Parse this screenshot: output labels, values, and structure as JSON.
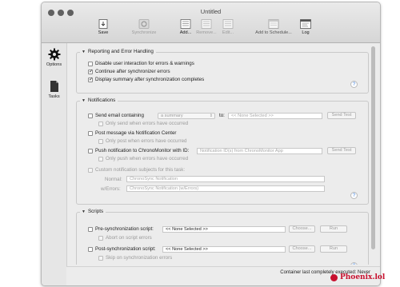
{
  "window": {
    "title": "Untitled"
  },
  "toolbar": {
    "save": "Save",
    "synchronize": "Synchronize",
    "add": "Add...",
    "remove": "Remove...",
    "edit": "Edit...",
    "add_to_schedule": "Add to Schedule...",
    "log": "Log"
  },
  "sidebar": {
    "options": "Options",
    "tasks": "Tasks"
  },
  "reporting": {
    "title": "Reporting and Error Handling",
    "items": [
      {
        "label": "Disable user interaction for errors & warnings",
        "checked": false
      },
      {
        "label": "Continue after synchronizer errors",
        "checked": true
      },
      {
        "label": "Display summary after synchronization completes",
        "checked": true
      }
    ]
  },
  "notifications": {
    "title": "Notifications",
    "send_email_label": "Send email containing",
    "send_email_select": "a summary",
    "to_label": "to:",
    "to_value": "<< None Selected >>",
    "send_test_label": "Send Test",
    "only_send_errors": "Only send when errors have occurred",
    "post_message": "Post message via Notification Center",
    "only_post_errors": "Only post when errors have occurred",
    "push_notification": "Push notification to ChronoMonitor with ID:",
    "push_placeholder": "Notification ID(s) from ChronoMonitor App",
    "only_push_errors": "Only push when errors have occurred",
    "custom_subjects": "Custom notification subjects for this task:",
    "normal_label": "Normal:",
    "normal_placeholder": "ChronoSync Notification",
    "errors_label": "w/Errors:",
    "errors_placeholder": "ChronoSync Notification (w/Errors)"
  },
  "scripts": {
    "title": "Scripts",
    "pre_label": "Pre-synchronization script:",
    "pre_value": "<< None Selected >>",
    "abort_errors": "Abort on script errors",
    "post_label": "Post-synchronization script:",
    "post_value": "<< None Selected >>",
    "skip_errors": "Skip on synchronization errors",
    "choose_label": "Choose...",
    "run_label": "Run"
  },
  "status": {
    "label": "Container last completely executed:",
    "value": "Never",
    "text": "Container last completely executed:  Never"
  },
  "watermark": {
    "text": "Phoenix.lol"
  },
  "colors": {
    "accent": "#3a7ee0",
    "watermark": "#c8102e"
  }
}
